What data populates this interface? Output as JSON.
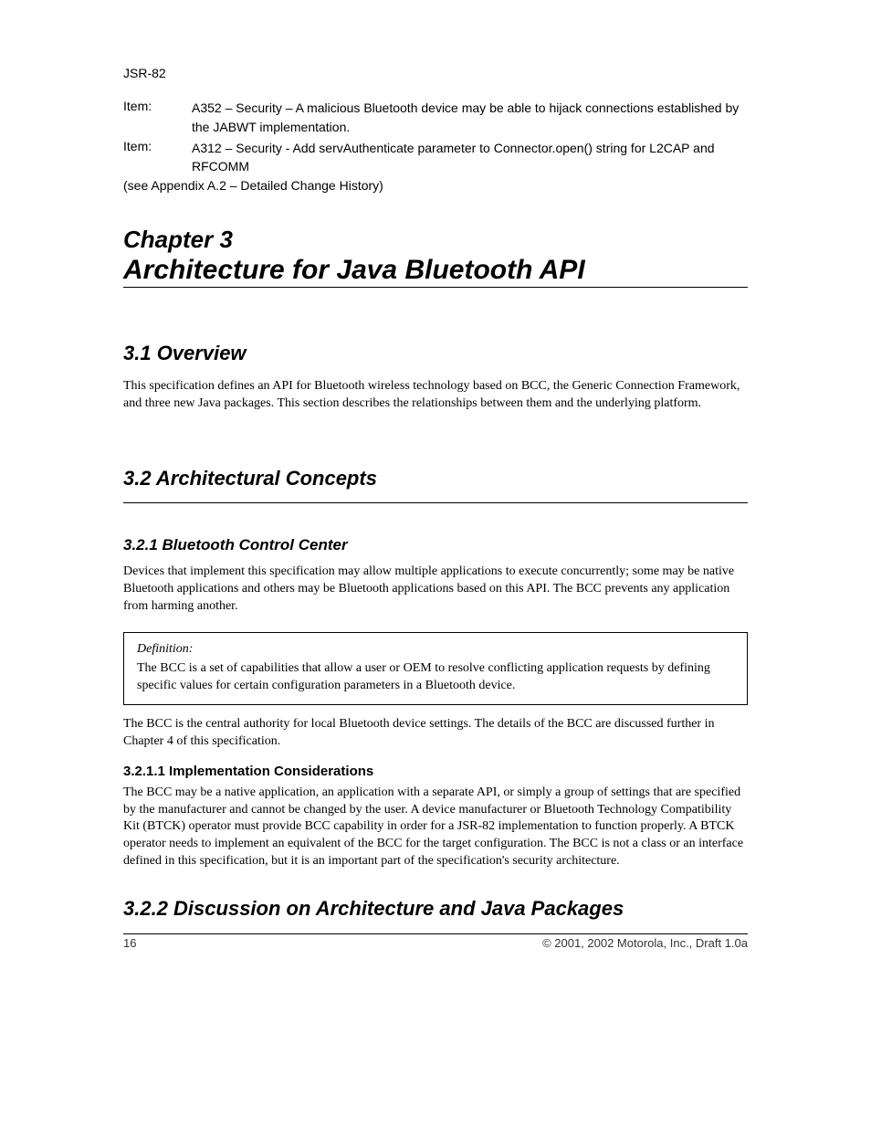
{
  "header": {
    "running": "JSR-82",
    "item_label": "Item:",
    "item_1": "A352 – Security – A malicious Bluetooth device may be able to hijack connections established by the JABWT implementation.",
    "item_2": "A312 – Security - Add servAuthenticate parameter to Connector.open() string for L2CAP and RFCOMM",
    "backref": "(see Appendix A.2 – Detailed Change History)"
  },
  "chapter": {
    "label": "Chapter 3",
    "title": "Architecture for Java Bluetooth API"
  },
  "sections": {
    "overview": {
      "heading": "3.1 Overview",
      "para": "This specification defines an API for Bluetooth wireless technology based on BCC, the Generic Connection Framework, and three new Java packages. This section describes the relationships between them and the underlying platform."
    },
    "concepts": {
      "heading": "3.2 Architectural Concepts"
    },
    "bcc": {
      "heading": "3.2.1 Bluetooth Control Center",
      "para1": "Devices that implement this specification may allow multiple applications to execute concurrently; some may be native Bluetooth applications and others may be Bluetooth applications based on this API. The BCC prevents any application from harming another.",
      "box_label": "Definition:",
      "box_text": "The BCC is a set of capabilities that allow a user or OEM to resolve conflicting application requests by defining specific values for certain configuration parameters in a Bluetooth device.",
      "para2": "The BCC is the central authority for local Bluetooth device settings. The details of the BCC are discussed further in Chapter 4 of this specification."
    },
    "considerations": {
      "heading": "3.2.1.1 Implementation Considerations",
      "para": "The BCC may be a native application, an application with a separate API, or simply a group of settings that are specified by the manufacturer and cannot be changed by the user. A device manufacturer or Bluetooth Technology Compatibility Kit (BTCK) operator must provide BCC capability in order for a JSR-82 implementation to function properly. A BTCK operator needs to implement an equivalent of the BCC for the target configuration. The BCC is not a class or an interface defined in this specification, but it is an important part of the specification's security architecture."
    },
    "discussion": {
      "heading": "3.2.2 Discussion on Architecture and Java Packages"
    }
  },
  "footer": {
    "page": "16",
    "text": "© 2001, 2002 Motorola, Inc., Draft  1.0a"
  }
}
